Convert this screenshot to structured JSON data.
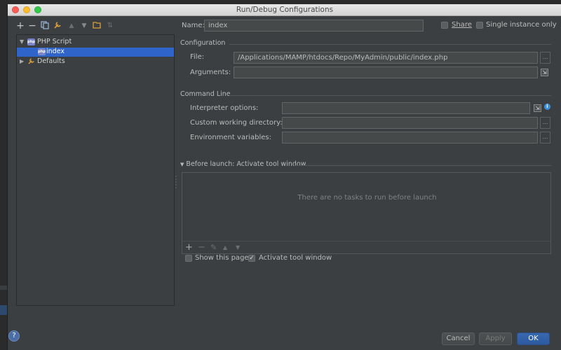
{
  "window": {
    "title": "Run/Debug Configurations"
  },
  "toolbar": {
    "add_icon": "plus-icon",
    "remove_icon": "minus-icon",
    "copy_icon": "copy-icon",
    "edit_defaults_icon": "wrench-icon",
    "move_up_icon": "arrow-up-icon",
    "move_down_icon": "arrow-down-icon",
    "folder_icon": "folder-icon",
    "sort_icon": "sort-icon"
  },
  "tree": {
    "items": [
      {
        "label": "PHP Script",
        "expanded": true,
        "level": 0
      },
      {
        "label": "index",
        "selected": true,
        "level": 1
      },
      {
        "label": "Defaults",
        "expanded": false,
        "level": 0
      }
    ]
  },
  "header": {
    "name_label": "Name:",
    "name_value": "index",
    "share_label": "Share",
    "single_instance_label": "Single instance only"
  },
  "configuration": {
    "section_label": "Configuration",
    "file_label": "File:",
    "file_value": "/Applications/MAMP/htdocs/Repo/MyAdmin/public/index.php",
    "arguments_label": "Arguments:",
    "arguments_value": ""
  },
  "command_line": {
    "section_label": "Command Line",
    "interpreter_label": "Interpreter options:",
    "interpreter_value": "",
    "working_dir_label": "Custom working directory:",
    "working_dir_value": "",
    "env_label": "Environment variables:",
    "env_value": ""
  },
  "before_launch": {
    "section_label": "Before launch: Activate tool window",
    "empty_text": "There are no tasks to run before launch",
    "show_page_label": "Show this page",
    "show_page_checked": false,
    "activate_label": "Activate tool window",
    "activate_checked": true
  },
  "footer": {
    "help": "?",
    "cancel_label": "Cancel",
    "apply_label": "Apply",
    "ok_label": "OK"
  },
  "colors": {
    "background": "#3c3f41",
    "selection": "#2f65ca",
    "primary_button": "#2d5aa0",
    "traffic_close": "#fc5f57",
    "traffic_minimize": "#fdbc2e",
    "traffic_zoom": "#34c84a"
  }
}
